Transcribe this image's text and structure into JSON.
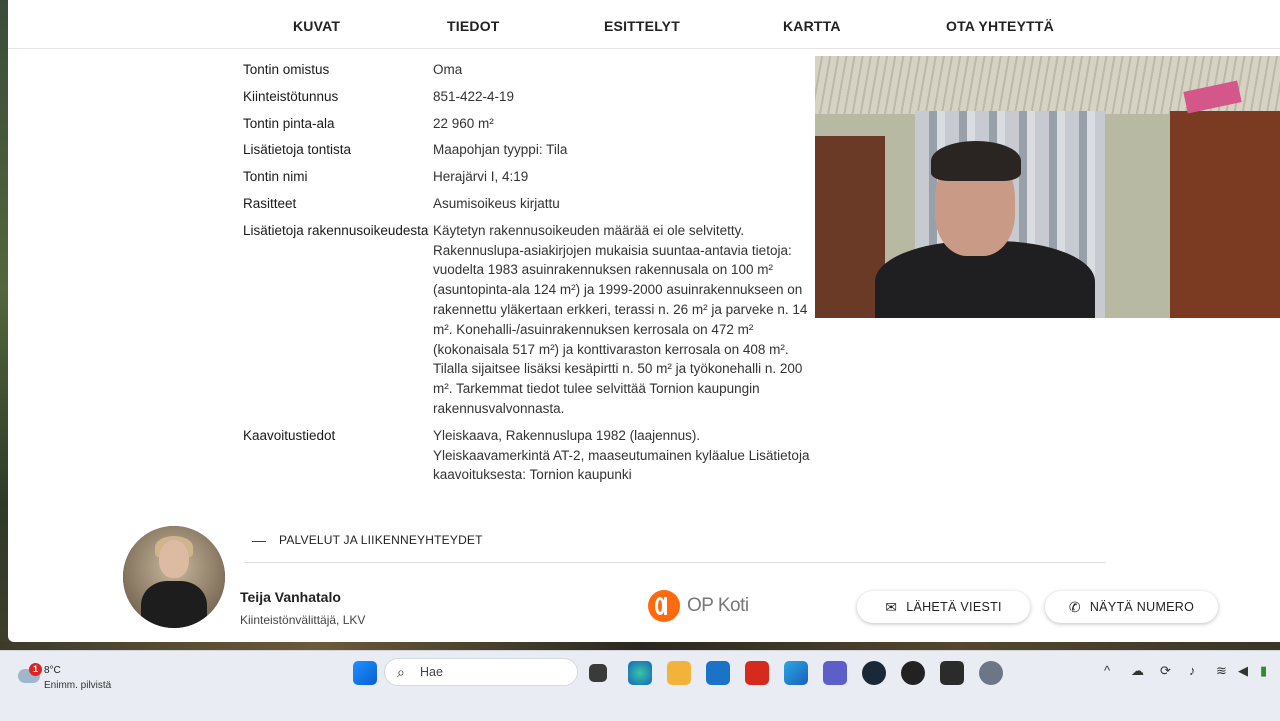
{
  "nav": {
    "items": [
      "KUVAT",
      "TIEDOT",
      "ESITTELYT",
      "KARTTA",
      "OTA YHTEYTTÄ"
    ]
  },
  "details": [
    {
      "label": "Tontin omistus",
      "value": "Oma"
    },
    {
      "label": "Kiinteistötunnus",
      "value": "851-422-4-19"
    },
    {
      "label": "Tontin pinta-ala",
      "value": "22 960 m²"
    },
    {
      "label": "Lisätietoja tontista",
      "value": "Maapohjan tyyppi: Tila"
    },
    {
      "label": "Tontin nimi",
      "value": "Herajärvi I, 4:19"
    },
    {
      "label": "Rasitteet",
      "value": "Asumisoikeus kirjattu"
    },
    {
      "label": "Lisätietoja rakennusoikeudesta",
      "value": "Käytetyn rakennusoikeuden määrää ei ole selvitetty. Rakennuslupa-asiakirjojen mukaisia suuntaa-antavia tietoja: vuodelta 1983 asuinrakennuksen rakennusala on 100 m² (asuntopinta-ala 124 m²) ja 1999-2000 asuinrakennukseen on rakennettu yläkertaan erkkeri, terassi n. 26 m² ja parveke n. 14 m². Konehalli-/asuinrakennuksen kerrosala on 472 m² (kokonaisala 517 m²) ja konttivaraston kerrosala on 408 m². Tilalla sijaitsee lisäksi kesäpirtti n. 50 m² ja työkonehalli n. 200 m². Tarkemmat tiedot tulee selvittää Tornion kaupungin rakennusvalvonnasta."
    },
    {
      "label": "Kaavoitustiedot",
      "value": "Yleiskaava, Rakennuslupa 1982 (laajennus). Yleiskaavamerkintä AT-2, maaseutumainen kyläalue Lisätietoja kaavoituksesta: Tornion kaupunki"
    }
  ],
  "section": {
    "dash": "—",
    "title": "PALVELUT JA LIIKENNEYHTEYDET"
  },
  "agent": {
    "name": "Teija Vanhatalo",
    "title": "Kiinteistönvälittäjä, LKV"
  },
  "brand": {
    "name": "OP Koti",
    "color": "#ff6a10"
  },
  "buttons": {
    "message": "LÄHETÄ VIESTI",
    "phone": "NÄYTÄ NUMERO"
  },
  "taskbar": {
    "weather_temp": "8°C",
    "weather_cond": "Enimm. pilvistä",
    "weather_badge": "1",
    "search_placeholder": "Hae"
  }
}
